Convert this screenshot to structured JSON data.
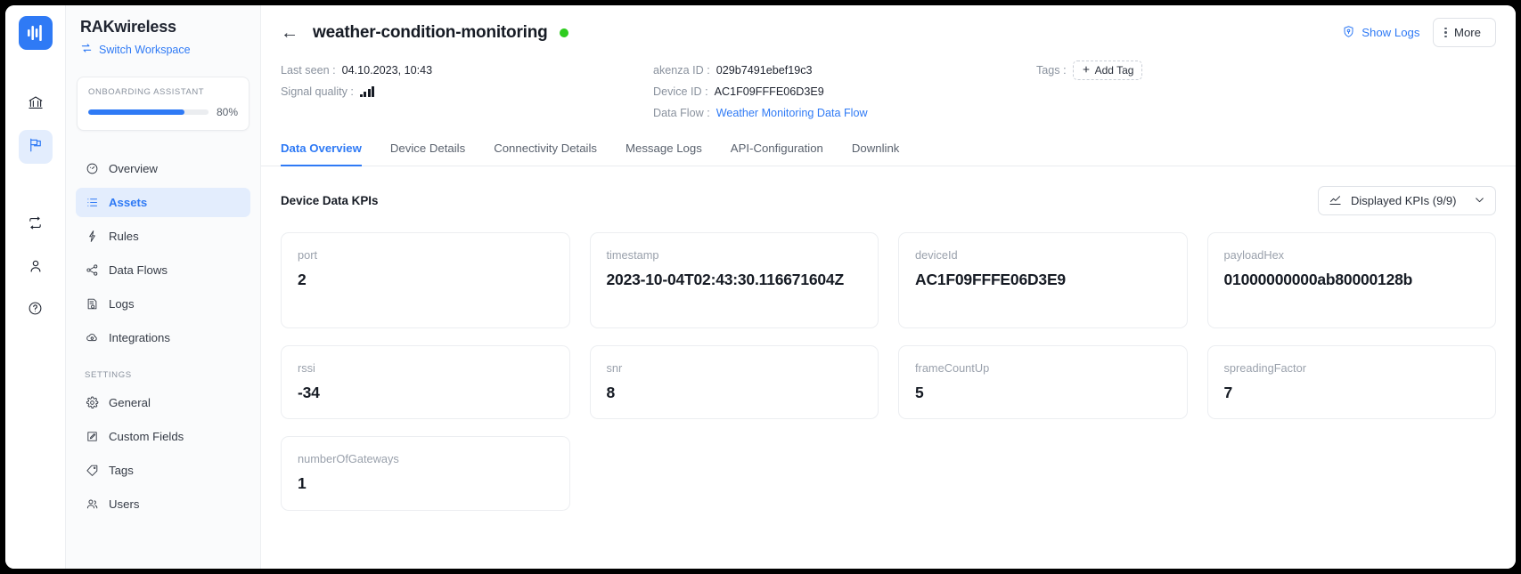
{
  "rail": {
    "logo_icon": "waveform-logo",
    "items": [
      {
        "name": "organization",
        "icon": "bank-icon",
        "active": false
      },
      {
        "name": "workspaces",
        "icon": "flag-icon",
        "active": true
      },
      {
        "name": "transfer",
        "icon": "repeat-icon",
        "active": false
      },
      {
        "name": "account",
        "icon": "user-icon",
        "active": false
      },
      {
        "name": "help",
        "icon": "question-circle-icon",
        "active": false
      }
    ]
  },
  "sidebar": {
    "brand": "RAKwireless",
    "switch_workspace": "Switch Workspace",
    "onboarding": {
      "label": "ONBOARDING ASSISTANT",
      "percent_text": "80%",
      "percent": 80
    },
    "items": [
      {
        "label": "Overview",
        "icon": "gauge-icon",
        "active": false
      },
      {
        "label": "Assets",
        "icon": "list-icon",
        "active": true
      },
      {
        "label": "Rules",
        "icon": "bolt-icon",
        "active": false
      },
      {
        "label": "Data Flows",
        "icon": "share-icon",
        "active": false
      },
      {
        "label": "Logs",
        "icon": "document-log-icon",
        "active": false
      },
      {
        "label": "Integrations",
        "icon": "cloud-icon",
        "active": false
      }
    ],
    "settings_label": "SETTINGS",
    "settings_items": [
      {
        "label": "General",
        "icon": "gear-icon"
      },
      {
        "label": "Custom Fields",
        "icon": "edit-square-icon"
      },
      {
        "label": "Tags",
        "icon": "tag-icon"
      },
      {
        "label": "Users",
        "icon": "users-icon"
      }
    ]
  },
  "header": {
    "back_icon": "arrow-left-icon",
    "title": "weather-condition-monitoring",
    "status_color": "#2ecc1f",
    "show_logs": "Show Logs",
    "show_logs_icon": "shield-log-icon",
    "more": "More",
    "more_icon": "vertical-dots-icon"
  },
  "meta": {
    "last_seen_key": "Last seen :",
    "last_seen_value": "04.10.2023, 10:43",
    "signal_key": "Signal quality :",
    "signal_bars": 4,
    "akenza_id_key": "akenza ID :",
    "akenza_id_value": "029b7491ebef19c3",
    "device_id_key": "Device ID :",
    "device_id_value": "AC1F09FFFE06D3E9",
    "data_flow_key": "Data Flow :",
    "data_flow_value": "Weather Monitoring Data Flow",
    "tags_key": "Tags :",
    "add_tag": "Add Tag"
  },
  "tabs": [
    {
      "label": "Data Overview",
      "active": true
    },
    {
      "label": "Device Details",
      "active": false
    },
    {
      "label": "Connectivity Details",
      "active": false
    },
    {
      "label": "Message Logs",
      "active": false
    },
    {
      "label": "API-Configuration",
      "active": false
    },
    {
      "label": "Downlink",
      "active": false
    }
  ],
  "content": {
    "section_title": "Device Data KPIs",
    "kpi_selector_label": "Displayed KPIs (9/9)",
    "kpi_selector_icon": "chart-line-icon",
    "kpi_selector_chevron": "chevron-down-icon",
    "kpis": [
      {
        "key": "port",
        "value": "2"
      },
      {
        "key": "timestamp",
        "value": "2023-10-04T02:43:30.116671604Z"
      },
      {
        "key": "deviceId",
        "value": "AC1F09FFFE06D3E9"
      },
      {
        "key": "payloadHex",
        "value": "01000000000ab80000128b"
      },
      {
        "key": "rssi",
        "value": "-34"
      },
      {
        "key": "snr",
        "value": "8"
      },
      {
        "key": "frameCountUp",
        "value": "5"
      },
      {
        "key": "spreadingFactor",
        "value": "7"
      },
      {
        "key": "numberOfGateways",
        "value": "1"
      }
    ]
  }
}
